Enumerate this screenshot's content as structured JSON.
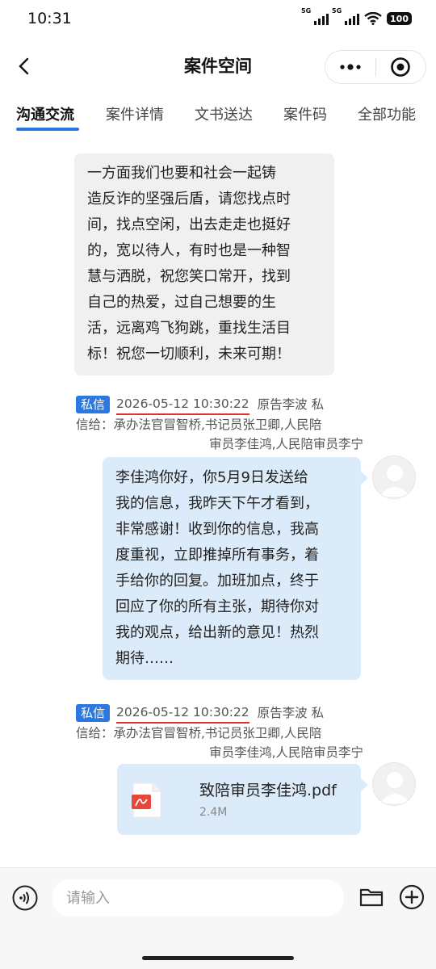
{
  "status_bar": {
    "time": "10:31",
    "signal1": "5G",
    "signal2": "5G",
    "battery": "100"
  },
  "header": {
    "title": "案件空间"
  },
  "tabs": [
    {
      "label": "沟通交流",
      "active": true
    },
    {
      "label": "案件详情",
      "active": false
    },
    {
      "label": "文书送达",
      "active": false
    },
    {
      "label": "案件码",
      "active": false
    },
    {
      "label": "全部功能",
      "active": false
    }
  ],
  "messages": {
    "received": {
      "lines": [
        "一方面我们也要和社会一起铸",
        "造反诈的坚强后盾，请您找点时",
        "间，找点空闲，出去走走也挺好",
        "的，宽以待人，有时也是一种智",
        "慧与洒脱，祝您笑口常开，找到",
        "自己的热爱，过自己想要的生",
        "活，远离鸡飞狗跳，重找生活目",
        "标！祝您一切顺利，未来可期！"
      ]
    },
    "sent1": {
      "badge": "私信",
      "timestamp": "2026-05-12 10:30:22",
      "sender": "原告李波  私",
      "recipients_line1": "信给：承办法官冒智桥,书记员张卫卿,人民陪",
      "recipients_line2": "审员李佳鸿,人民陪审员李宁",
      "lines": [
        "李佳鸿你好，你5月9日发送给",
        "我的信息，我昨天下午才看到，",
        "非常感谢！收到你的信息，我高",
        "度重视，立即推掉所有事务，着",
        "手给你的回复。加班加点，终于",
        "回应了你的所有主张，期待你对",
        "我的观点，给出新的意见！热烈",
        "期待……"
      ]
    },
    "sent2": {
      "badge": "私信",
      "timestamp": "2026-05-12 10:30:22",
      "sender": "原告李波  私",
      "recipients_line1": "信给：承办法官冒智桥,书记员张卫卿,人民陪",
      "recipients_line2": "审员李佳鸿,人民陪审员李宁",
      "file_name": "致陪审员李佳鸿.pdf",
      "file_size": "2.4M"
    }
  },
  "input_bar": {
    "placeholder": "请输入"
  },
  "colors": {
    "accent": "#2a78e0",
    "sent_bubble": "#dcebfa",
    "received_bubble": "#f0f0f0",
    "underline_red": "#d33333"
  }
}
